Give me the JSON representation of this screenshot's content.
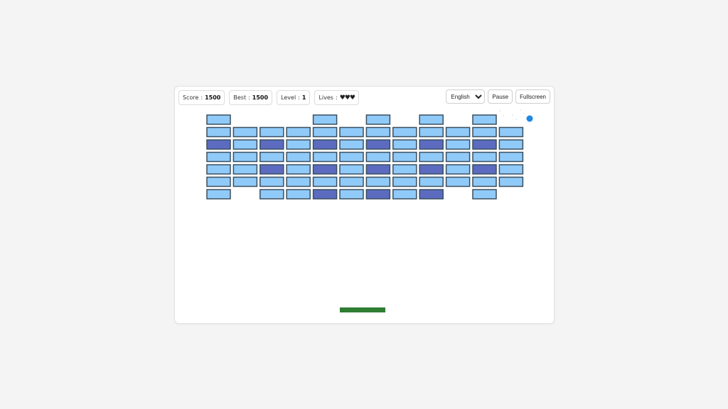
{
  "hud": {
    "score_label": "Score",
    "score_value": "1500",
    "best_label": "Best",
    "best_value": "1500",
    "level_label": "Level",
    "level_value": "1",
    "lives_label": "Lives",
    "lives_value": "♥♥♥",
    "separator": ":"
  },
  "controls": {
    "language": "English",
    "pause_label": "Pause",
    "fullscreen_label": "Fullscreen"
  },
  "colors": {
    "brick_light": "#90caf9",
    "brick_dark": "#5c6bc0",
    "paddle": "#2e7d32",
    "ball": "#1e88e5"
  },
  "game": {
    "bricks_grid": [
      "L...L.L.L.L.",
      "LLLLLLLLLLLL",
      "DLDLDLDLDLDL",
      "LLLLLLLLLLLL",
      "LLDLDLDLDLDL",
      "LLLLLLLLLLLL",
      "L.LLDLDLD.L."
    ]
  }
}
